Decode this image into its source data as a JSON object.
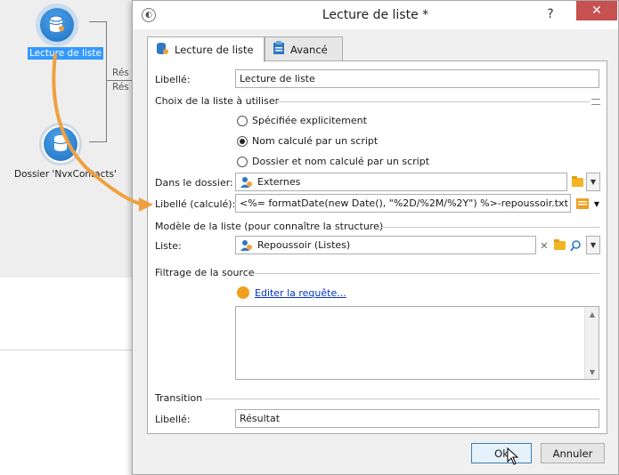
{
  "workflow": {
    "node1_label": "Lecture de liste",
    "node2_label": "Dossier 'NvxContacts'",
    "link_label_1": "Rés",
    "link_label_2": "Rés"
  },
  "dialog": {
    "title": "Lecture de liste *",
    "window_buttons": {
      "help": "?",
      "close": "✕"
    },
    "tabs": [
      {
        "label": "Lecture de liste",
        "active": true
      },
      {
        "label": "Avancé",
        "active": false
      }
    ],
    "libelle": {
      "label": "Libellé:",
      "value": "Lecture de liste"
    },
    "choix": {
      "title": "Choix de la liste à utiliser",
      "options": [
        {
          "label": "Spécifiée explicitement",
          "selected": false
        },
        {
          "label": "Nom calculé par un script",
          "selected": true
        },
        {
          "label": "Dossier et nom calculé par un script",
          "selected": false
        }
      ]
    },
    "dossier": {
      "label": "Dans le dossier:",
      "value": "Externes"
    },
    "libelle_calc": {
      "label": "Libellé (calculé):",
      "value": "<%= formatDate(new Date(), \"%2D/%2M/%2Y\") %>-repoussoir.txt"
    },
    "modele": {
      "title": "Modèle de la liste (pour connaître la structure)",
      "liste_label": "Liste:",
      "liste_value": "Repoussoir (Listes)"
    },
    "filtrage": {
      "title": "Filtrage de la source",
      "edit_link": "Editer la requête..."
    },
    "transition": {
      "title": "Transition",
      "label": "Libellé:",
      "value": "Résultat"
    },
    "ok_label": "Ok",
    "cancel_label": "Annuler"
  },
  "colors": {
    "accent_link": "#0033cc",
    "selection": "#3399ff",
    "arrow": "#f0a040",
    "close_button": "#c75050"
  }
}
